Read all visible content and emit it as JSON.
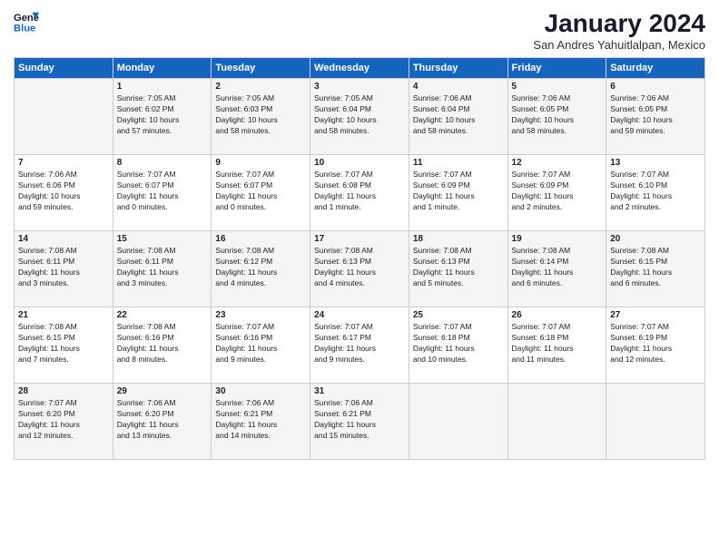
{
  "logo": {
    "line1": "General",
    "line2": "Blue"
  },
  "title": "January 2024",
  "subtitle": "San Andres Yahuitlalpan, Mexico",
  "days_of_week": [
    "Sunday",
    "Monday",
    "Tuesday",
    "Wednesday",
    "Thursday",
    "Friday",
    "Saturday"
  ],
  "weeks": [
    [
      {
        "day": "",
        "content": ""
      },
      {
        "day": "1",
        "content": "Sunrise: 7:05 AM\nSunset: 6:02 PM\nDaylight: 10 hours\nand 57 minutes."
      },
      {
        "day": "2",
        "content": "Sunrise: 7:05 AM\nSunset: 6:03 PM\nDaylight: 10 hours\nand 58 minutes."
      },
      {
        "day": "3",
        "content": "Sunrise: 7:05 AM\nSunset: 6:04 PM\nDaylight: 10 hours\nand 58 minutes."
      },
      {
        "day": "4",
        "content": "Sunrise: 7:06 AM\nSunset: 6:04 PM\nDaylight: 10 hours\nand 58 minutes."
      },
      {
        "day": "5",
        "content": "Sunrise: 7:06 AM\nSunset: 6:05 PM\nDaylight: 10 hours\nand 58 minutes."
      },
      {
        "day": "6",
        "content": "Sunrise: 7:06 AM\nSunset: 6:05 PM\nDaylight: 10 hours\nand 59 minutes."
      }
    ],
    [
      {
        "day": "7",
        "content": "Sunrise: 7:06 AM\nSunset: 6:06 PM\nDaylight: 10 hours\nand 59 minutes."
      },
      {
        "day": "8",
        "content": "Sunrise: 7:07 AM\nSunset: 6:07 PM\nDaylight: 11 hours\nand 0 minutes."
      },
      {
        "day": "9",
        "content": "Sunrise: 7:07 AM\nSunset: 6:07 PM\nDaylight: 11 hours\nand 0 minutes."
      },
      {
        "day": "10",
        "content": "Sunrise: 7:07 AM\nSunset: 6:08 PM\nDaylight: 11 hours\nand 1 minute."
      },
      {
        "day": "11",
        "content": "Sunrise: 7:07 AM\nSunset: 6:09 PM\nDaylight: 11 hours\nand 1 minute."
      },
      {
        "day": "12",
        "content": "Sunrise: 7:07 AM\nSunset: 6:09 PM\nDaylight: 11 hours\nand 2 minutes."
      },
      {
        "day": "13",
        "content": "Sunrise: 7:07 AM\nSunset: 6:10 PM\nDaylight: 11 hours\nand 2 minutes."
      }
    ],
    [
      {
        "day": "14",
        "content": "Sunrise: 7:08 AM\nSunset: 6:11 PM\nDaylight: 11 hours\nand 3 minutes."
      },
      {
        "day": "15",
        "content": "Sunrise: 7:08 AM\nSunset: 6:11 PM\nDaylight: 11 hours\nand 3 minutes."
      },
      {
        "day": "16",
        "content": "Sunrise: 7:08 AM\nSunset: 6:12 PM\nDaylight: 11 hours\nand 4 minutes."
      },
      {
        "day": "17",
        "content": "Sunrise: 7:08 AM\nSunset: 6:13 PM\nDaylight: 11 hours\nand 4 minutes."
      },
      {
        "day": "18",
        "content": "Sunrise: 7:08 AM\nSunset: 6:13 PM\nDaylight: 11 hours\nand 5 minutes."
      },
      {
        "day": "19",
        "content": "Sunrise: 7:08 AM\nSunset: 6:14 PM\nDaylight: 11 hours\nand 6 minutes."
      },
      {
        "day": "20",
        "content": "Sunrise: 7:08 AM\nSunset: 6:15 PM\nDaylight: 11 hours\nand 6 minutes."
      }
    ],
    [
      {
        "day": "21",
        "content": "Sunrise: 7:08 AM\nSunset: 6:15 PM\nDaylight: 11 hours\nand 7 minutes."
      },
      {
        "day": "22",
        "content": "Sunrise: 7:08 AM\nSunset: 6:16 PM\nDaylight: 11 hours\nand 8 minutes."
      },
      {
        "day": "23",
        "content": "Sunrise: 7:07 AM\nSunset: 6:16 PM\nDaylight: 11 hours\nand 9 minutes."
      },
      {
        "day": "24",
        "content": "Sunrise: 7:07 AM\nSunset: 6:17 PM\nDaylight: 11 hours\nand 9 minutes."
      },
      {
        "day": "25",
        "content": "Sunrise: 7:07 AM\nSunset: 6:18 PM\nDaylight: 11 hours\nand 10 minutes."
      },
      {
        "day": "26",
        "content": "Sunrise: 7:07 AM\nSunset: 6:18 PM\nDaylight: 11 hours\nand 11 minutes."
      },
      {
        "day": "27",
        "content": "Sunrise: 7:07 AM\nSunset: 6:19 PM\nDaylight: 11 hours\nand 12 minutes."
      }
    ],
    [
      {
        "day": "28",
        "content": "Sunrise: 7:07 AM\nSunset: 6:20 PM\nDaylight: 11 hours\nand 12 minutes."
      },
      {
        "day": "29",
        "content": "Sunrise: 7:06 AM\nSunset: 6:20 PM\nDaylight: 11 hours\nand 13 minutes."
      },
      {
        "day": "30",
        "content": "Sunrise: 7:06 AM\nSunset: 6:21 PM\nDaylight: 11 hours\nand 14 minutes."
      },
      {
        "day": "31",
        "content": "Sunrise: 7:06 AM\nSunset: 6:21 PM\nDaylight: 11 hours\nand 15 minutes."
      },
      {
        "day": "",
        "content": ""
      },
      {
        "day": "",
        "content": ""
      },
      {
        "day": "",
        "content": ""
      }
    ]
  ]
}
